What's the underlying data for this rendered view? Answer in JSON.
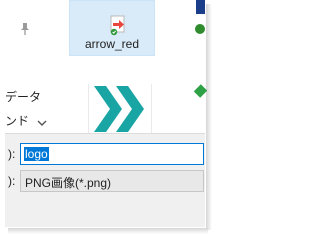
{
  "nav": {
    "label_1": "データ",
    "label_2": "ンド",
    "pin_icon": "pin-icon",
    "scroll_icon": "chevron-down-icon"
  },
  "files": {
    "selected_item": {
      "label": "arrow_red",
      "icon": "arrow-red-file-icon"
    },
    "logo_item": {
      "icon": "logo-chevrons-image",
      "accent_color": "#1aa5a5"
    },
    "selection_color": "#d9ebf9"
  },
  "dialog": {
    "filename_prefix": "):",
    "filename_value": "logo",
    "filetype_prefix": "):",
    "filetype_value": "PNG画像(*.png)",
    "focus_color": "#0078d7"
  }
}
